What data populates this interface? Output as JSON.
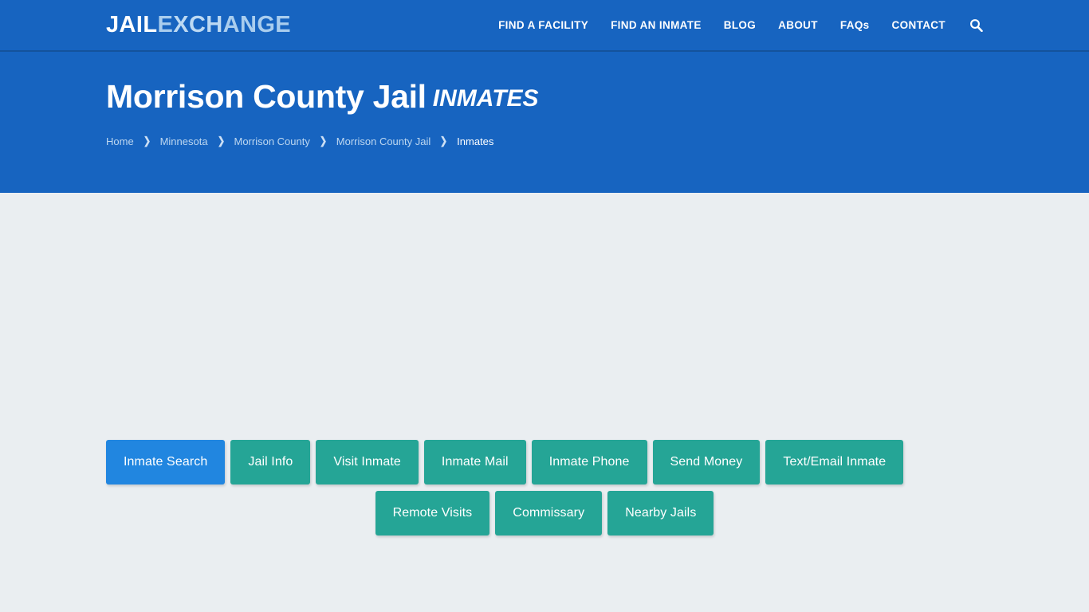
{
  "brand": {
    "logo_part1": "JAIL",
    "logo_part2": "E",
    "logo_part3": "XCH",
    "logo_part4": "ANGE",
    "logo_full": "JAILEXCHANGE"
  },
  "nav": {
    "items": [
      {
        "label": "FIND A FACILITY",
        "name": "nav-item-find-a-facility"
      },
      {
        "label": "FIND AN INMATE",
        "name": "nav-item-find-an-inmate"
      },
      {
        "label": "BLOG",
        "name": "nav-item-blog"
      },
      {
        "label": "ABOUT",
        "name": "nav-item-about"
      },
      {
        "label": "FAQs",
        "name": "nav-item-faqs"
      },
      {
        "label": "CONTACT",
        "name": "nav-item-contact"
      }
    ],
    "search_icon": "search-icon"
  },
  "hero": {
    "title": "Morrison County Jail",
    "title_suffix": "INMATES",
    "breadcrumb": [
      {
        "label": "Home",
        "current": false
      },
      {
        "label": "Minnesota",
        "current": false
      },
      {
        "label": "Morrison County",
        "current": false
      },
      {
        "label": "Morrison County Jail",
        "current": false
      },
      {
        "label": "Inmates",
        "current": true
      }
    ],
    "breadcrumb_separator": "❯"
  },
  "main": {
    "buttons_row1": [
      {
        "label": "Inmate Search",
        "active": true
      },
      {
        "label": "Jail Info",
        "active": false
      },
      {
        "label": "Visit Inmate",
        "active": false
      },
      {
        "label": "Inmate Mail",
        "active": false
      },
      {
        "label": "Inmate Phone",
        "active": false
      },
      {
        "label": "Send Money",
        "active": false
      },
      {
        "label": "Text/Email Inmate",
        "active": false
      }
    ],
    "buttons_row2": [
      {
        "label": "Remote Visits",
        "active": false
      },
      {
        "label": "Commissary",
        "active": false
      },
      {
        "label": "Nearby Jails",
        "active": false
      }
    ]
  },
  "colors": {
    "brand_blue": "#1764c0",
    "nav_border": "#14529c",
    "teal": "#25a596",
    "active_blue": "#2186e0",
    "page_bg": "#eaeef1",
    "logo_light": "#a9cdee"
  }
}
